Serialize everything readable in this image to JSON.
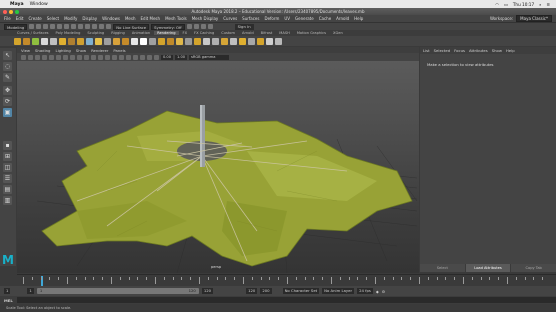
{
  "mac_menubar": {
    "app_name": "Maya",
    "items": [
      "Window"
    ],
    "time": "Thu 10:17"
  },
  "window": {
    "title": "Autodesk Maya 2018.2 – Educational Version: /Users/23407895/Documents/leaves.mb"
  },
  "menubar": {
    "items": [
      "File",
      "Edit",
      "Create",
      "Select",
      "Modify",
      "Display",
      "Windows",
      "Mesh",
      "Edit Mesh",
      "Mesh Tools",
      "Mesh Display",
      "Curves",
      "Surfaces",
      "Deform",
      "UV",
      "Generate",
      "Cache",
      "Arnold",
      "Help"
    ],
    "workspace_label": "Workspace:",
    "workspace_value": "Maya Classic*"
  },
  "statusline": {
    "menuset": "Modeling",
    "live_surface": "No Live Surface",
    "symmetry": "Symmetry: Off",
    "sign_in": "Sign In"
  },
  "shelf": {
    "tabs": [
      "Curves / Surfaces",
      "Poly Modeling",
      "Sculpting",
      "Rigging",
      "Animation",
      "Rendering",
      "FX",
      "FX Caching",
      "Custom",
      "Arnold",
      "Bifrost",
      "MASH",
      "Motion Graphics",
      "XGen"
    ],
    "active_tab": "Rendering",
    "icon_colors": [
      "#d4a42c",
      "#c48a2a",
      "#8fbf3f",
      "#d9d9d9",
      "#c0c0c0",
      "#e0b030",
      "#b08030",
      "#d0a030",
      "#7fb0d0",
      "#e5c04a",
      "#9f9f9f",
      "#d7a13a",
      "#c48a2a",
      "#e8e8e8",
      "#ffffff",
      "#a0a0a0",
      "#d4a42c",
      "#c08a2a",
      "#e0b84a",
      "#9a9a9a",
      "#d4a42c",
      "#c8c8c8",
      "#b0b0b0",
      "#d6a637",
      "#bfbfbf",
      "#e0b030",
      "#a8a8a8",
      "#d4a42c",
      "#cfcfcf",
      "#b8b8b8"
    ]
  },
  "viewport": {
    "menu": [
      "View",
      "Shading",
      "Lighting",
      "Show",
      "Renderer",
      "Panels"
    ],
    "exposure": "0.00",
    "gamma": "1.00",
    "colorspace": "sRGB gamma",
    "camera": "persp"
  },
  "attribute_editor": {
    "menu": [
      "List",
      "Selected",
      "Focus",
      "Attributes",
      "Show",
      "Help"
    ],
    "message": "Make a selection to view attributes",
    "buttons": [
      "Select",
      "Load Attributes",
      "Copy Tab"
    ],
    "active_button": "Load Attributes"
  },
  "time_slider": {
    "current_frame": "1"
  },
  "range_slider": {
    "start": "1",
    "inner_start": "1",
    "bar_start": "1",
    "bar_end": "120",
    "inner_end": "120",
    "end_a": "120",
    "end_b": "200",
    "character_set": "No Character Set",
    "anim_layer": "No Anim Layer",
    "fps": "24 fps"
  },
  "command_line": {
    "label": "MEL"
  },
  "help_line": {
    "text": "Scale Tool: Select an object to scale."
  },
  "colors": {
    "accent": "#5285a6",
    "maya_logo": "#19b1c9",
    "leaf": "#9aa33a",
    "timeline_playhead": "#3fa9d9"
  }
}
